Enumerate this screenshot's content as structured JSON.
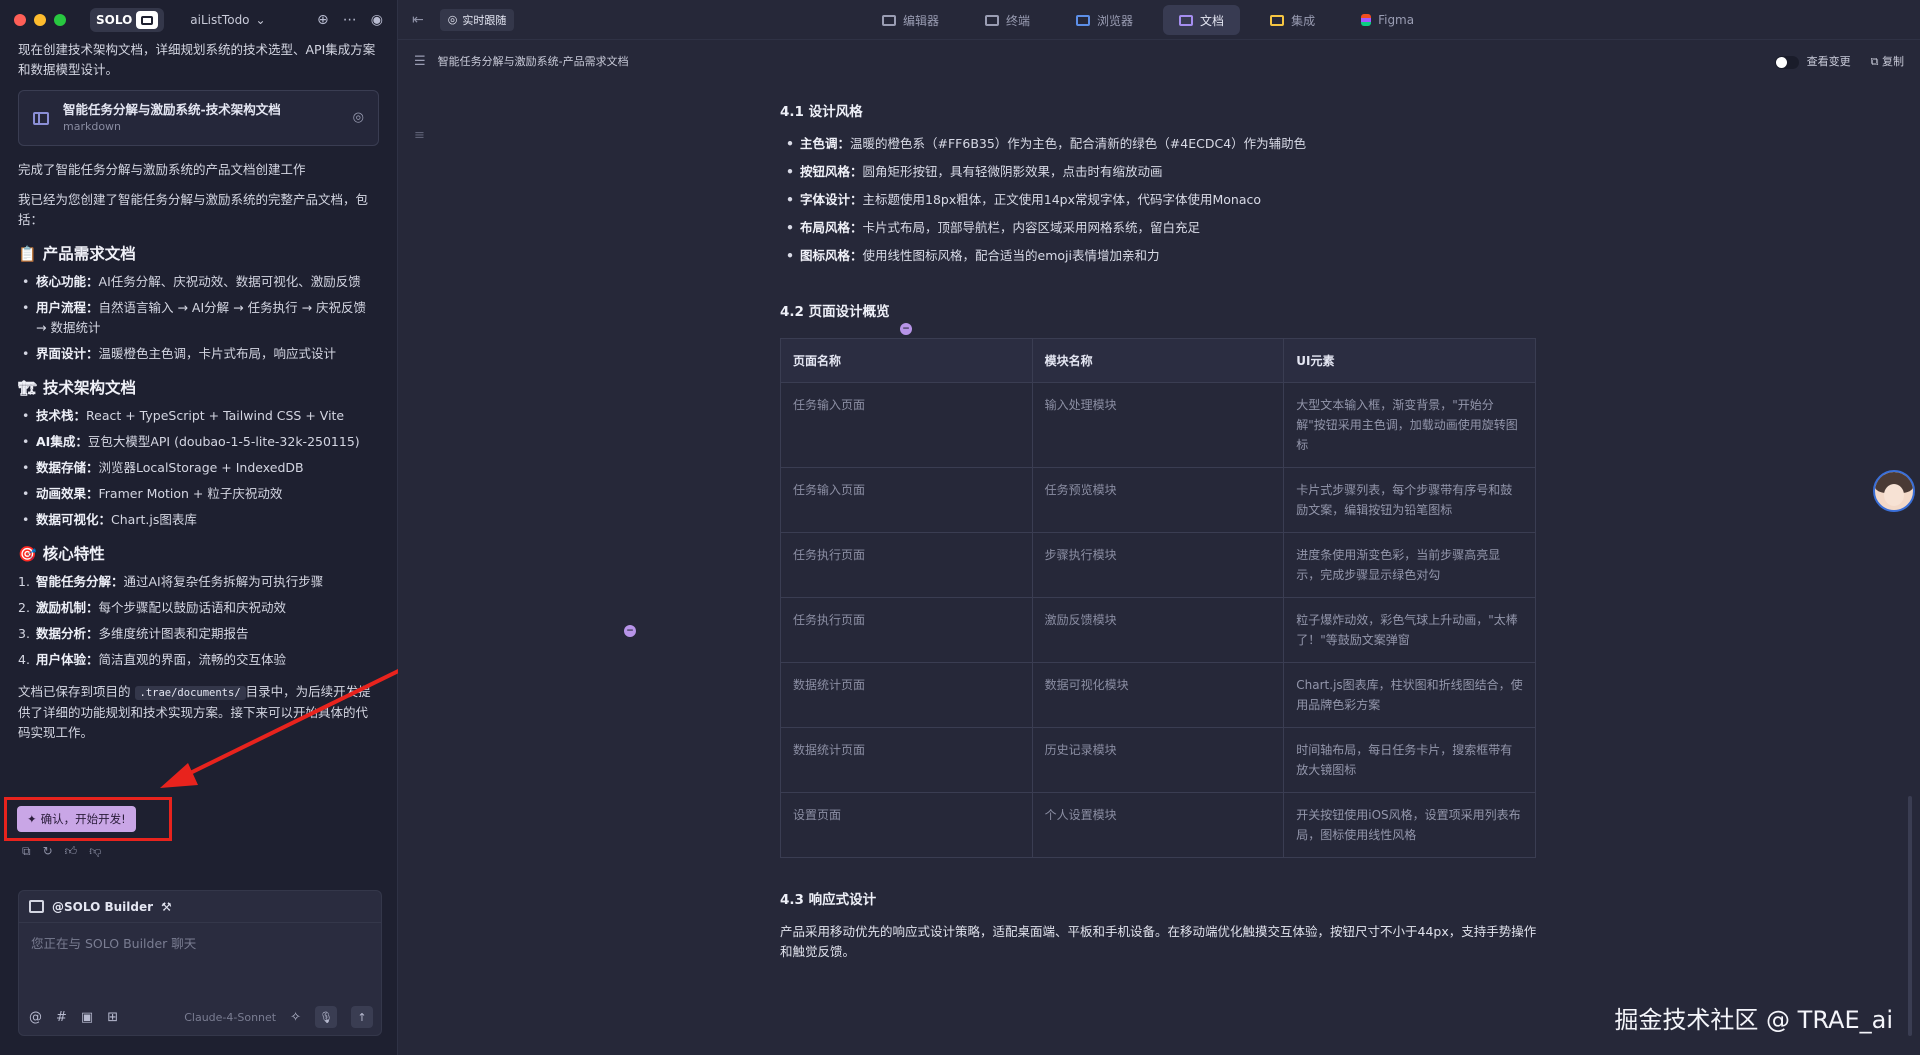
{
  "window": {
    "app_badge": "SOLO",
    "project_name": "aiListTodo"
  },
  "chat": {
    "intro": "现在创建技术架构文档，详细规划系统的技术选型、API集成方案和数据模型设计。",
    "doc_card": {
      "title": "智能任务分解与激励系统-技术架构文档",
      "subtitle": "markdown"
    },
    "done_text": "完成了智能任务分解与激励系统的产品文档创建工作",
    "summary_text": "我已经为您创建了智能任务分解与激励系统的完整产品文档，包括：",
    "section1": {
      "title": "产品需求文档",
      "emoji": "📋",
      "items": [
        {
          "key": "核心功能：",
          "text": "AI任务分解、庆祝动效、数据可视化、激励反馈"
        },
        {
          "key": "用户流程：",
          "text": "自然语言输入 → AI分解 → 任务执行 → 庆祝反馈 → 数据统计"
        },
        {
          "key": "界面设计：",
          "text": "温暖橙色主色调，卡片式布局，响应式设计"
        }
      ]
    },
    "section2": {
      "title": "技术架构文档",
      "emoji": "🏗",
      "items": [
        {
          "key": "技术栈：",
          "text": "React + TypeScript + Tailwind CSS + Vite"
        },
        {
          "key": "AI集成：",
          "text": "豆包大模型API (doubao-1-5-lite-32k-250115)"
        },
        {
          "key": "数据存储：",
          "text": "浏览器LocalStorage + IndexedDB"
        },
        {
          "key": "动画效果：",
          "text": "Framer Motion + 粒子庆祝动效"
        },
        {
          "key": "数据可视化：",
          "text": "Chart.js图表库"
        }
      ]
    },
    "section3": {
      "title": "核心特性",
      "emoji": "🎯",
      "items": [
        {
          "num": "1.",
          "key": "智能任务分解：",
          "text": "通过AI将复杂任务拆解为可执行步骤"
        },
        {
          "num": "2.",
          "key": "激励机制：",
          "text": "每个步骤配以鼓励话语和庆祝动效"
        },
        {
          "num": "3.",
          "key": "数据分析：",
          "text": "多维度统计图表和定期报告"
        },
        {
          "num": "4.",
          "key": "用户体验：",
          "text": "简洁直观的界面，流畅的交互体验"
        }
      ]
    },
    "saved_text_1": "文档已保存到项目的",
    "saved_path": ".trae/documents/",
    "saved_text_2": "目录中，为后续开发提供了详细的功能规划和技术实现方案。接下来可以开始具体的代码实现工作。",
    "confirm_button": "确认，开始开发!",
    "input": {
      "agent_name": "@SOLO Builder",
      "placeholder": "您正在与 SOLO Builder 聊天",
      "model": "Claude-4-Sonnet"
    }
  },
  "editor": {
    "live_follow": "实时跟随",
    "tabs": [
      {
        "label": "编辑器"
      },
      {
        "label": "终端"
      },
      {
        "label": "浏览器"
      },
      {
        "label": "文档"
      },
      {
        "label": "集成"
      },
      {
        "label": "Figma"
      }
    ],
    "doc_title": "智能任务分解与激励系统-产品需求文档",
    "view_changes": "查看变更",
    "copy": "复制"
  },
  "doc": {
    "h41": "4.1 设计风格",
    "style_items": [
      {
        "key": "主色调：",
        "text": "温暖的橙色系（#FF6B35）作为主色，配合清新的绿色（#4ECDC4）作为辅助色"
      },
      {
        "key": "按钮风格：",
        "text": "圆角矩形按钮，具有轻微阴影效果，点击时有缩放动画"
      },
      {
        "key": "字体设计：",
        "text": "主标题使用18px粗体，正文使用14px常规字体，代码字体使用Monaco"
      },
      {
        "key": "布局风格：",
        "text": "卡片式布局，顶部导航栏，内容区域采用网格系统，留白充足"
      },
      {
        "key": "图标风格：",
        "text": "使用线性图标风格，配合适当的emoji表情增加亲和力"
      }
    ],
    "h42": "4.2 页面设计概览",
    "table": {
      "headers": [
        "页面名称",
        "模块名称",
        "UI元素"
      ],
      "rows": [
        [
          "任务输入页面",
          "输入处理模块",
          "大型文本输入框，渐变背景，\"开始分解\"按钮采用主色调，加载动画使用旋转图标"
        ],
        [
          "任务输入页面",
          "任务预览模块",
          "卡片式步骤列表，每个步骤带有序号和鼓励文案，编辑按钮为铅笔图标"
        ],
        [
          "任务执行页面",
          "步骤执行模块",
          "进度条使用渐变色彩，当前步骤高亮显示，完成步骤显示绿色对勾"
        ],
        [
          "任务执行页面",
          "激励反馈模块",
          "粒子爆炸动效，彩色气球上升动画，\"太棒了！\"等鼓励文案弹窗"
        ],
        [
          "数据统计页面",
          "数据可视化模块",
          "Chart.js图表库，柱状图和折线图结合，使用品牌色彩方案"
        ],
        [
          "数据统计页面",
          "历史记录模块",
          "时间轴布局，每日任务卡片，搜索框带有放大镜图标"
        ],
        [
          "设置页面",
          "个人设置模块",
          "开关按钮使用iOS风格，设置项采用列表布局，图标使用线性风格"
        ]
      ]
    },
    "h43": "4.3 响应式设计",
    "responsive_text": "产品采用移动优先的响应式设计策略，适配桌面端、平板和手机设备。在移动端优化触摸交互体验，按钮尺寸不小于44px，支持手势操作和触觉反馈。"
  },
  "watermark": "掘金技术社区 @ TRAE_ai"
}
